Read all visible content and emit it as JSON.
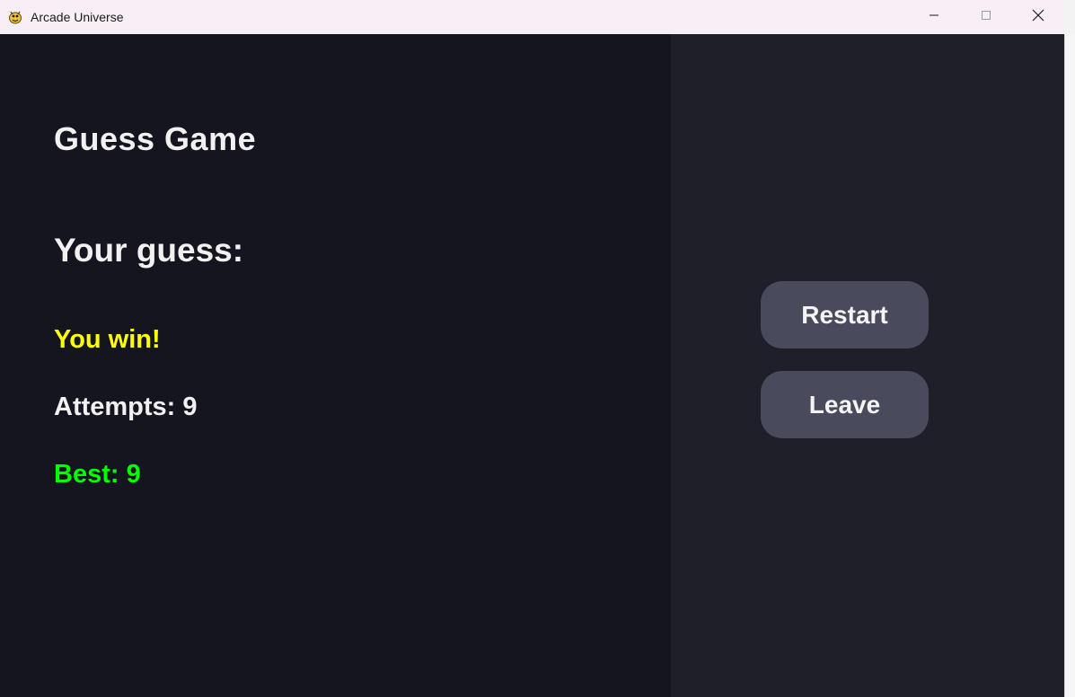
{
  "window": {
    "title": "Arcade Universe",
    "app_icon": "pygame-snake-icon"
  },
  "controls": {
    "minimize_icon": "minimize-icon",
    "maximize_icon": "maximize-icon",
    "close_icon": "close-icon"
  },
  "game": {
    "title": "Guess Game",
    "guess_label": "Your guess:",
    "status": "You win!",
    "attempts": "Attempts: 9",
    "best": "Best: 9"
  },
  "side_panel": {
    "restart_label": "Restart",
    "leave_label": "Leave"
  },
  "colors": {
    "game_bg": "#15151f",
    "panel_bg": "#1f1f2a",
    "button_bg": "#4a4a5d",
    "win_text": "#ffff00",
    "best_text": "#00ff00",
    "text": "#f1f1f1"
  }
}
